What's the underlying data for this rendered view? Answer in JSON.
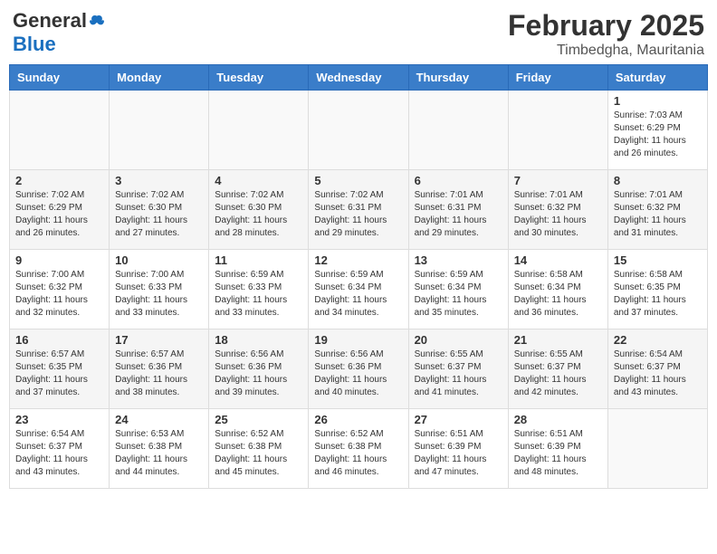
{
  "header": {
    "logo_general": "General",
    "logo_blue": "Blue",
    "month_year": "February 2025",
    "location": "Timbedgha, Mauritania"
  },
  "weekdays": [
    "Sunday",
    "Monday",
    "Tuesday",
    "Wednesday",
    "Thursday",
    "Friday",
    "Saturday"
  ],
  "weeks": [
    [
      {
        "day": "",
        "info": ""
      },
      {
        "day": "",
        "info": ""
      },
      {
        "day": "",
        "info": ""
      },
      {
        "day": "",
        "info": ""
      },
      {
        "day": "",
        "info": ""
      },
      {
        "day": "",
        "info": ""
      },
      {
        "day": "1",
        "info": "Sunrise: 7:03 AM\nSunset: 6:29 PM\nDaylight: 11 hours\nand 26 minutes."
      }
    ],
    [
      {
        "day": "2",
        "info": "Sunrise: 7:02 AM\nSunset: 6:29 PM\nDaylight: 11 hours\nand 26 minutes."
      },
      {
        "day": "3",
        "info": "Sunrise: 7:02 AM\nSunset: 6:30 PM\nDaylight: 11 hours\nand 27 minutes."
      },
      {
        "day": "4",
        "info": "Sunrise: 7:02 AM\nSunset: 6:30 PM\nDaylight: 11 hours\nand 28 minutes."
      },
      {
        "day": "5",
        "info": "Sunrise: 7:02 AM\nSunset: 6:31 PM\nDaylight: 11 hours\nand 29 minutes."
      },
      {
        "day": "6",
        "info": "Sunrise: 7:01 AM\nSunset: 6:31 PM\nDaylight: 11 hours\nand 29 minutes."
      },
      {
        "day": "7",
        "info": "Sunrise: 7:01 AM\nSunset: 6:32 PM\nDaylight: 11 hours\nand 30 minutes."
      },
      {
        "day": "8",
        "info": "Sunrise: 7:01 AM\nSunset: 6:32 PM\nDaylight: 11 hours\nand 31 minutes."
      }
    ],
    [
      {
        "day": "9",
        "info": "Sunrise: 7:00 AM\nSunset: 6:32 PM\nDaylight: 11 hours\nand 32 minutes."
      },
      {
        "day": "10",
        "info": "Sunrise: 7:00 AM\nSunset: 6:33 PM\nDaylight: 11 hours\nand 33 minutes."
      },
      {
        "day": "11",
        "info": "Sunrise: 6:59 AM\nSunset: 6:33 PM\nDaylight: 11 hours\nand 33 minutes."
      },
      {
        "day": "12",
        "info": "Sunrise: 6:59 AM\nSunset: 6:34 PM\nDaylight: 11 hours\nand 34 minutes."
      },
      {
        "day": "13",
        "info": "Sunrise: 6:59 AM\nSunset: 6:34 PM\nDaylight: 11 hours\nand 35 minutes."
      },
      {
        "day": "14",
        "info": "Sunrise: 6:58 AM\nSunset: 6:34 PM\nDaylight: 11 hours\nand 36 minutes."
      },
      {
        "day": "15",
        "info": "Sunrise: 6:58 AM\nSunset: 6:35 PM\nDaylight: 11 hours\nand 37 minutes."
      }
    ],
    [
      {
        "day": "16",
        "info": "Sunrise: 6:57 AM\nSunset: 6:35 PM\nDaylight: 11 hours\nand 37 minutes."
      },
      {
        "day": "17",
        "info": "Sunrise: 6:57 AM\nSunset: 6:36 PM\nDaylight: 11 hours\nand 38 minutes."
      },
      {
        "day": "18",
        "info": "Sunrise: 6:56 AM\nSunset: 6:36 PM\nDaylight: 11 hours\nand 39 minutes."
      },
      {
        "day": "19",
        "info": "Sunrise: 6:56 AM\nSunset: 6:36 PM\nDaylight: 11 hours\nand 40 minutes."
      },
      {
        "day": "20",
        "info": "Sunrise: 6:55 AM\nSunset: 6:37 PM\nDaylight: 11 hours\nand 41 minutes."
      },
      {
        "day": "21",
        "info": "Sunrise: 6:55 AM\nSunset: 6:37 PM\nDaylight: 11 hours\nand 42 minutes."
      },
      {
        "day": "22",
        "info": "Sunrise: 6:54 AM\nSunset: 6:37 PM\nDaylight: 11 hours\nand 43 minutes."
      }
    ],
    [
      {
        "day": "23",
        "info": "Sunrise: 6:54 AM\nSunset: 6:37 PM\nDaylight: 11 hours\nand 43 minutes."
      },
      {
        "day": "24",
        "info": "Sunrise: 6:53 AM\nSunset: 6:38 PM\nDaylight: 11 hours\nand 44 minutes."
      },
      {
        "day": "25",
        "info": "Sunrise: 6:52 AM\nSunset: 6:38 PM\nDaylight: 11 hours\nand 45 minutes."
      },
      {
        "day": "26",
        "info": "Sunrise: 6:52 AM\nSunset: 6:38 PM\nDaylight: 11 hours\nand 46 minutes."
      },
      {
        "day": "27",
        "info": "Sunrise: 6:51 AM\nSunset: 6:39 PM\nDaylight: 11 hours\nand 47 minutes."
      },
      {
        "day": "28",
        "info": "Sunrise: 6:51 AM\nSunset: 6:39 PM\nDaylight: 11 hours\nand 48 minutes."
      },
      {
        "day": "",
        "info": ""
      }
    ]
  ]
}
